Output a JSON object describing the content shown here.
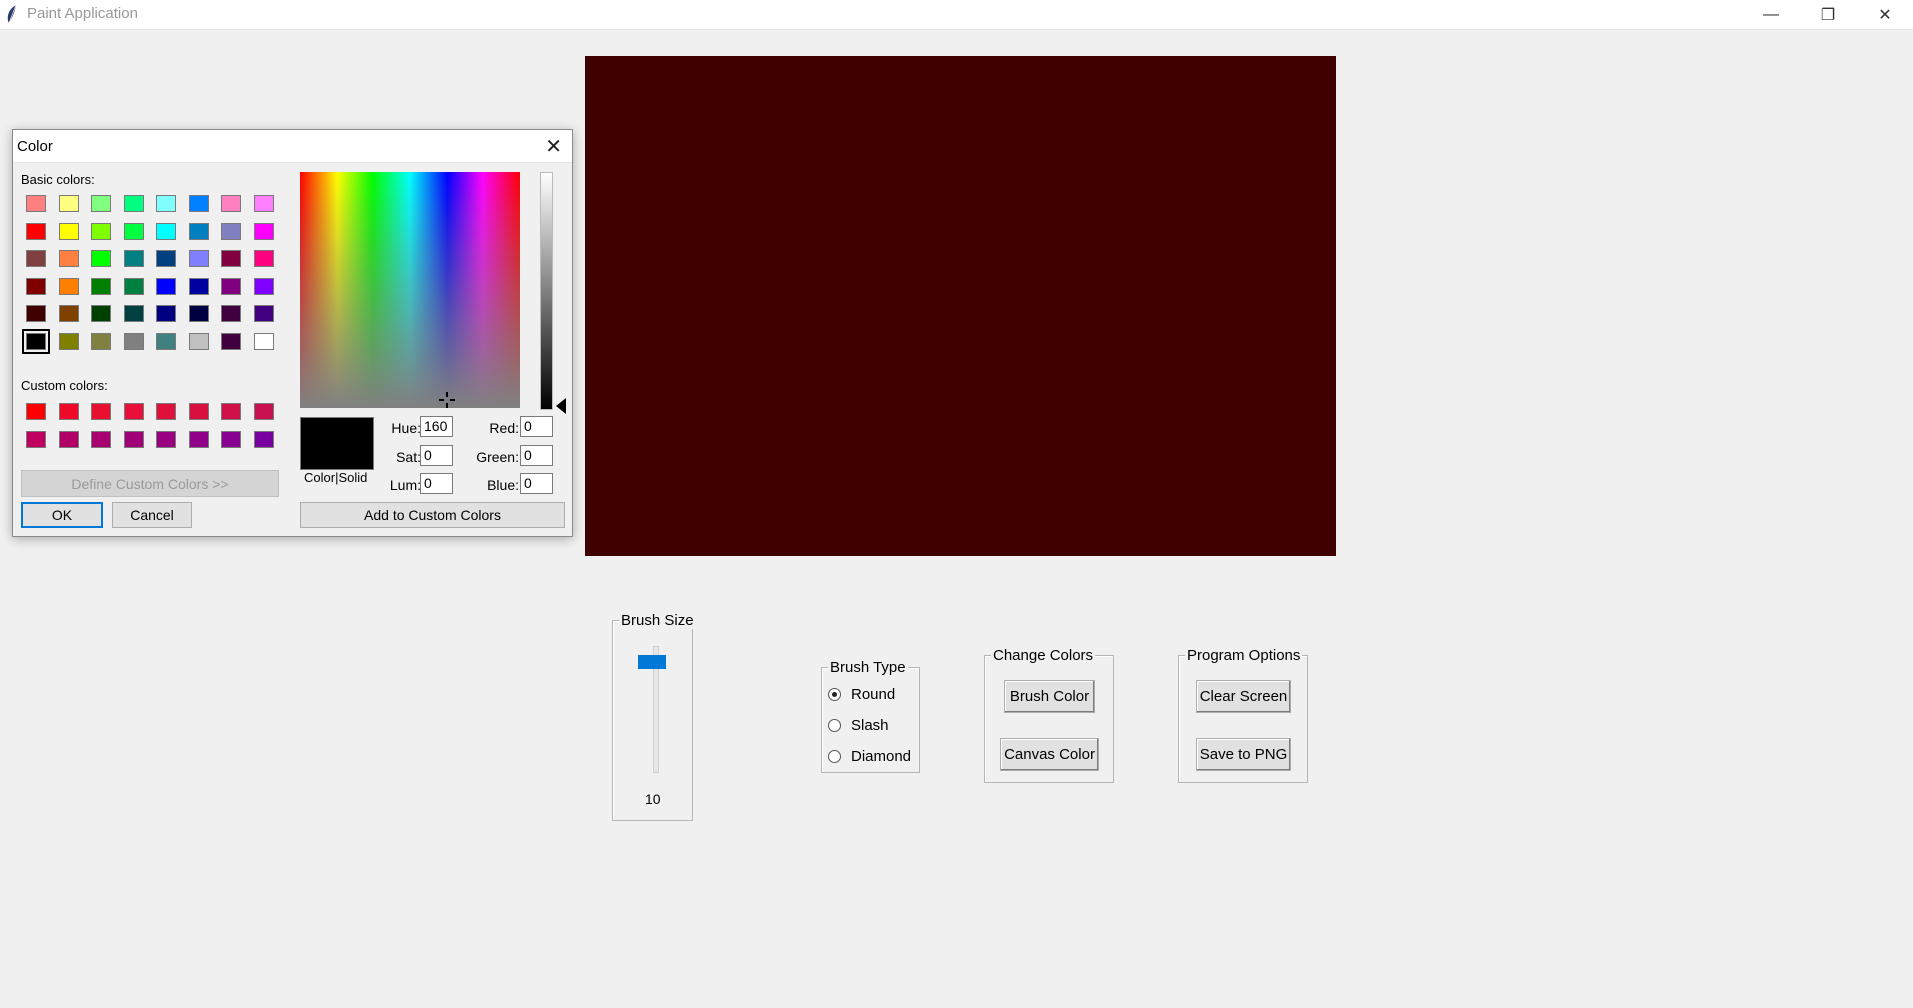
{
  "window": {
    "title": "Paint Application",
    "controls": {
      "minimize": "—",
      "restore": "❐",
      "close": "✕"
    }
  },
  "canvas": {
    "background": "#400000"
  },
  "brush_size": {
    "title": "Brush Size",
    "value": "10",
    "level": 10
  },
  "brush_type": {
    "title": "Brush Type",
    "options": [
      {
        "label": "Round",
        "selected": true
      },
      {
        "label": "Slash",
        "selected": false
      },
      {
        "label": "Diamond",
        "selected": false
      }
    ]
  },
  "change_colors": {
    "title": "Change Colors",
    "brush_color": "Brush Color",
    "canvas_color": "Canvas Color"
  },
  "program_options": {
    "title": "Program Options",
    "clear_screen": "Clear Screen",
    "save_png": "Save to PNG"
  },
  "color_dialog": {
    "title": "Color",
    "basic_label": "Basic colors:",
    "basic_colors": [
      "#ff8080",
      "#ffff80",
      "#80ff80",
      "#00ff80",
      "#80ffff",
      "#0080ff",
      "#ff80c0",
      "#ff80ff",
      "#ff0000",
      "#ffff00",
      "#80ff00",
      "#00ff40",
      "#00ffff",
      "#0080c0",
      "#8080c0",
      "#ff00ff",
      "#804040",
      "#ff8040",
      "#00ff00",
      "#008080",
      "#004080",
      "#8080ff",
      "#800040",
      "#ff0080",
      "#800000",
      "#ff8000",
      "#008000",
      "#008040",
      "#0000ff",
      "#0000a0",
      "#800080",
      "#8000ff",
      "#400000",
      "#804000",
      "#004000",
      "#004040",
      "#000080",
      "#000040",
      "#400040",
      "#400080",
      "#000000",
      "#808000",
      "#808040",
      "#808080",
      "#408080",
      "#c0c0c0",
      "#400040",
      "#ffffff"
    ],
    "selected_basic_index": 40,
    "custom_label": "Custom colors:",
    "custom_colors": [
      "#ff0000",
      "#f00828",
      "#e8102e",
      "#e8103a",
      "#e0103c",
      "#d81040",
      "#d01048",
      "#c81050",
      "#c00060",
      "#b00068",
      "#a80070",
      "#a00078",
      "#980080",
      "#900088",
      "#880090",
      "#7800a0"
    ],
    "define_custom": "Define Custom Colors >>",
    "ok": "OK",
    "cancel": "Cancel",
    "color_solid": "Color|Solid",
    "preview_color": "#000000",
    "add_custom": "Add to Custom Colors",
    "fields": {
      "hue_label": "Hue:",
      "hue": "160",
      "sat_label": "Sat:",
      "sat": "0",
      "lum_label": "Lum:",
      "lum": "0",
      "red_label": "Red:",
      "red": "0",
      "green_label": "Green:",
      "green": "0",
      "blue_label": "Blue:",
      "blue": "0"
    }
  }
}
